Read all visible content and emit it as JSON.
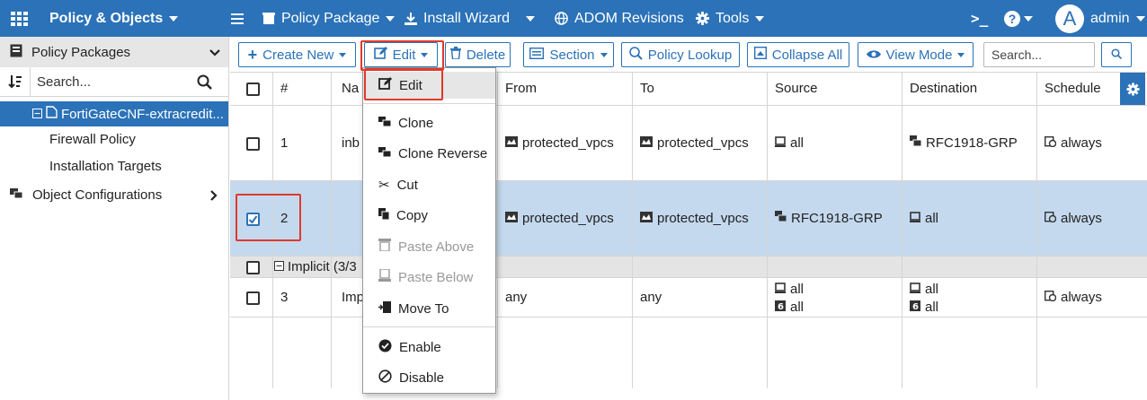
{
  "topbar": {
    "module": "Policy & Objects",
    "policy_package": "Policy Package",
    "install_wizard": "Install Wizard",
    "adom_revisions": "ADOM Revisions",
    "tools": "Tools",
    "cli_icon": ">_",
    "help_icon": "?",
    "avatar_letter": "A",
    "user": "admin"
  },
  "sidebar": {
    "header": "Policy Packages",
    "search_placeholder": "Search...",
    "selected_package": "FortiGateCNF-extracredit...",
    "children": [
      "Firewall Policy",
      "Installation Targets"
    ],
    "object_configurations": "Object Configurations"
  },
  "toolbar": {
    "create_new": "Create New",
    "edit": "Edit",
    "delete": "Delete",
    "section": "Section",
    "policy_lookup": "Policy Lookup",
    "collapse_all": "Collapse All",
    "view_mode": "View Mode",
    "search_placeholder": "Search..."
  },
  "table": {
    "columns": [
      "#",
      "Na",
      "From",
      "To",
      "Source",
      "Destination",
      "Schedule"
    ],
    "rows": [
      {
        "seq": "1",
        "name": "inb",
        "from": "protected_vpcs",
        "to": "protected_vpcs",
        "source": "all",
        "destination": "RFC1918-GRP",
        "schedule": "always",
        "checked": false
      },
      {
        "seq": "2",
        "name": "",
        "from": "protected_vpcs",
        "to": "protected_vpcs",
        "source": "RFC1918-GRP",
        "destination": "all",
        "schedule": "always",
        "checked": true
      }
    ],
    "implicit_label": "Implicit (3/3",
    "implicit_row": {
      "seq": "3",
      "name": "Imp",
      "from": "any",
      "to": "any",
      "source": [
        "all",
        "all"
      ],
      "destination": [
        "all",
        "all"
      ],
      "schedule": "always"
    }
  },
  "edit_menu": {
    "items": [
      {
        "label": "Edit",
        "icon": "edit-icon",
        "disabled": false
      },
      {
        "label": "Clone",
        "icon": "clone-icon",
        "disabled": false
      },
      {
        "label": "Clone Reverse",
        "icon": "clone-reverse-icon",
        "disabled": false
      },
      {
        "label": "Cut",
        "icon": "scissors-icon",
        "disabled": false
      },
      {
        "label": "Copy",
        "icon": "copy-icon",
        "disabled": false
      },
      {
        "label": "Paste Above",
        "icon": "paste-above-icon",
        "disabled": true
      },
      {
        "label": "Paste Below",
        "icon": "paste-below-icon",
        "disabled": true
      },
      {
        "label": "Move To",
        "icon": "move-to-icon",
        "disabled": false
      },
      {
        "label": "Enable",
        "icon": "enable-icon",
        "disabled": false
      },
      {
        "label": "Disable",
        "icon": "disable-icon",
        "disabled": false
      }
    ]
  },
  "colors": {
    "brand_blue": "#2b72b8",
    "selected_row": "#c4d9ee",
    "highlight_red": "#e0392b"
  }
}
